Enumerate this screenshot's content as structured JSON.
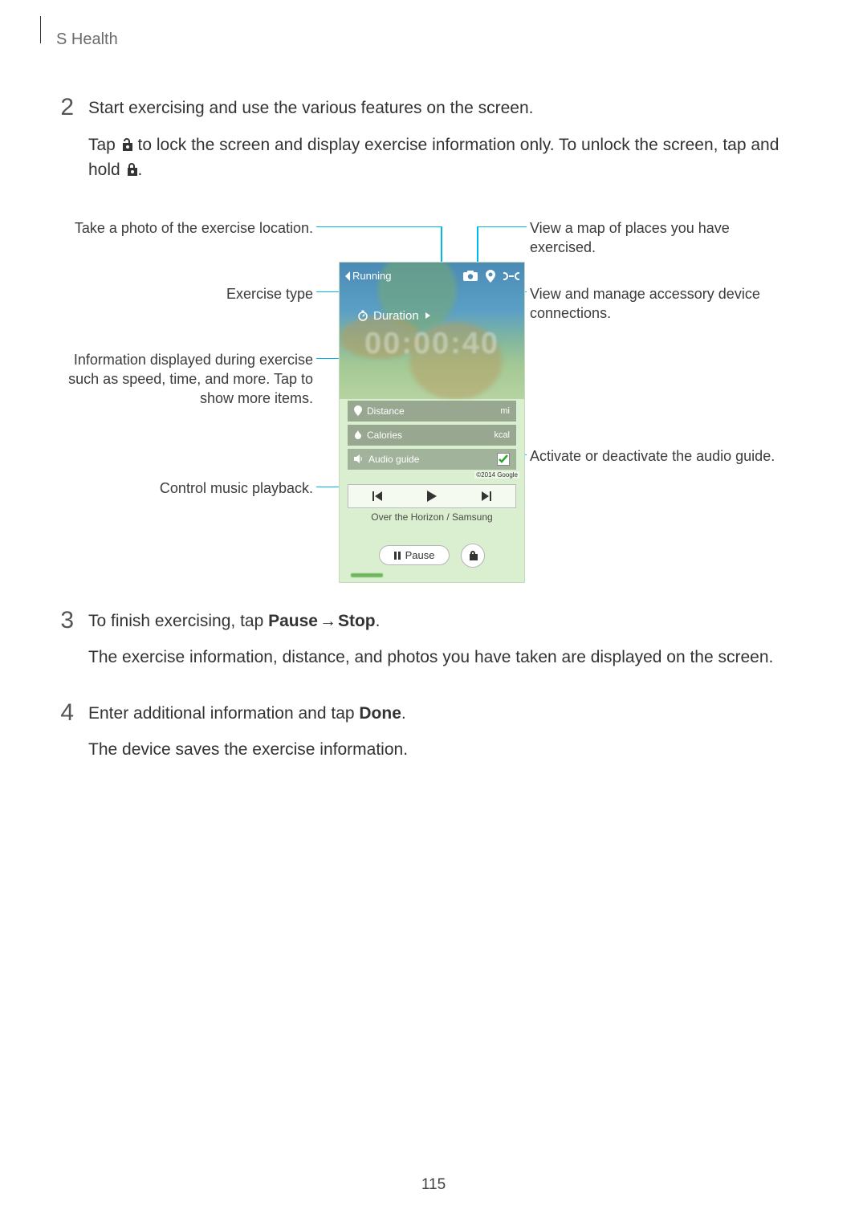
{
  "header": {
    "section_title": "S Health"
  },
  "steps": {
    "s2": {
      "num": "2",
      "p1": "Start exercising and use the various features on the screen.",
      "p2a": "Tap ",
      "p2b": " to lock the screen and display exercise information only. To unlock the screen, tap and hold ",
      "p2c": "."
    },
    "s3": {
      "num": "3",
      "p1a": "To finish exercising, tap ",
      "p1_pause": "Pause",
      "p1_arrow": " → ",
      "p1_stop": "Stop",
      "p1b": ".",
      "p2": "The exercise information, distance, and photos you have taken are displayed on the screen."
    },
    "s4": {
      "num": "4",
      "p1a": "Enter additional information and tap ",
      "p1_done": "Done",
      "p1b": ".",
      "p2": "The device saves the exercise information."
    }
  },
  "callouts": {
    "photo": "Take a photo of the exercise location.",
    "exercise_type": "Exercise type",
    "info_displayed": "Information displayed during exercise such as speed, time, and more. Tap to show more items.",
    "music": "Control music playback.",
    "map": "View a map of places you have exercised.",
    "accessory": "View and manage accessory device connections.",
    "audio_guide": "Activate or deactivate the audio guide."
  },
  "phone": {
    "back_label": "Running",
    "duration_label": "Duration",
    "timer": "00:00:40",
    "rows": {
      "distance": {
        "label": "Distance",
        "unit": "mi"
      },
      "calories": {
        "label": "Calories",
        "unit": "kcal"
      },
      "audio": {
        "label": "Audio guide"
      }
    },
    "copyright": "©2014 Google",
    "track": "Over the Horizon / Samsung",
    "pause": "Pause"
  },
  "page_number": "115"
}
